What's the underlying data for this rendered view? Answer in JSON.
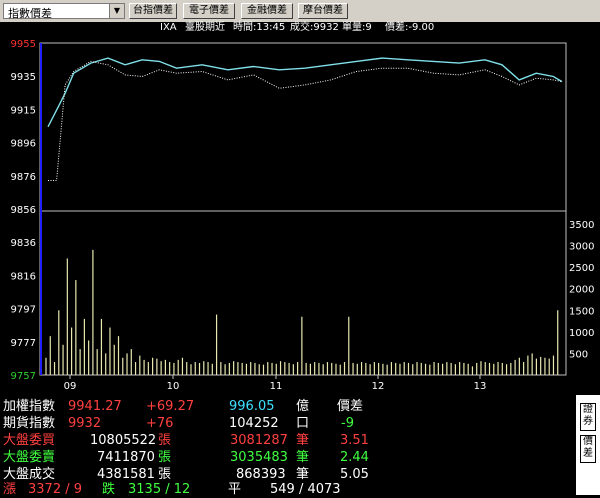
{
  "toolbar": {
    "selector_value": "指數價差",
    "buttons": [
      "台指價差",
      "電子價差",
      "金融價差",
      "摩台價差"
    ]
  },
  "info_bar": {
    "code": "IXA",
    "name": "臺股期近",
    "time": "時間:13:45",
    "deal": "成交:9932",
    "volume": "單量:9",
    "spread": "價差:-9.00"
  },
  "colors": {
    "index_line": "#7fe0e8",
    "futures_line": "#ffffff",
    "volume_bar": "#e8e8b0",
    "price_axis_text": "#ffffff",
    "top_price_text": "#ff3030",
    "base_price_text": "#30d030",
    "up": "#ff4040",
    "down": "#40ff40",
    "label_white": "#ffffff"
  },
  "chart_data": {
    "type": "line",
    "title": "",
    "price_axis": {
      "ticks": [
        "9955",
        "9935",
        "9915",
        "9896",
        "9876",
        "9856",
        "9836",
        "9816",
        "9797",
        "9777",
        "9757"
      ],
      "top": 9955,
      "bottom": 9757
    },
    "volume_axis": {
      "ticks": [
        "3500",
        "3000",
        "2500",
        "2000",
        "1500",
        "1000",
        "500"
      ],
      "max": 3800
    },
    "x_ticks": [
      "09",
      "10",
      "11",
      "12",
      "13"
    ],
    "series": [
      {
        "x": [
          "08:45",
          "08:50",
          "08:55",
          "09:00",
          "09:10",
          "09:20",
          "09:30",
          "09:40",
          "09:50",
          "10:00",
          "10:15",
          "10:30",
          "10:45",
          "11:00",
          "11:15",
          "11:30",
          "11:45",
          "12:00",
          "12:15",
          "12:30",
          "12:45",
          "13:00",
          "13:10",
          "13:20",
          "13:30",
          "13:40",
          "13:45"
        ],
        "values": [
          9905,
          9915,
          9925,
          9937,
          9943,
          9946,
          9942,
          9945,
          9944,
          9940,
          9942,
          9939,
          9941,
          9939,
          9940,
          9942,
          9944,
          9946,
          9945,
          9944,
          9943,
          9945,
          9942,
          9933,
          9937,
          9935,
          9932
        ]
      },
      {
        "x": [
          "08:45",
          "08:50",
          "08:55",
          "09:00",
          "09:10",
          "09:20",
          "09:30",
          "09:40",
          "09:50",
          "10:00",
          "10:15",
          "10:30",
          "10:45",
          "11:00",
          "11:15",
          "11:30",
          "11:45",
          "12:00",
          "12:15",
          "12:30",
          "12:45",
          "13:00",
          "13:10",
          "13:20",
          "13:30",
          "13:40",
          "13:45"
        ],
        "values": [
          9873,
          9873,
          9930,
          9938,
          9944,
          9942,
          9936,
          9935,
          9939,
          9937,
          9938,
          9933,
          9936,
          9928,
          9930,
          9933,
          9938,
          9940,
          9940,
          9937,
          9936,
          9939,
          9935,
          9930,
          9934,
          9933,
          9932
        ]
      }
    ],
    "volume": [
      400,
      900,
      300,
      1500,
      700,
      2700,
      1100,
      2200,
      600,
      1300,
      800,
      2900,
      600,
      1300,
      500,
      1100,
      700,
      900,
      400,
      500,
      600,
      300,
      450,
      350,
      300,
      400,
      380,
      320,
      350,
      300,
      280,
      350,
      400,
      300,
      250,
      300,
      280,
      320,
      300,
      260,
      1400,
      300,
      250,
      280,
      320,
      300,
      280,
      260,
      300,
      280,
      250,
      240,
      300,
      280,
      260,
      320,
      300,
      280,
      250,
      300,
      1350,
      280,
      260,
      300,
      280,
      250,
      300,
      280,
      260,
      240,
      300,
      1350,
      280,
      260,
      300,
      280,
      250,
      300,
      280,
      260,
      240,
      300,
      280,
      260,
      300,
      280,
      250,
      300,
      280,
      260,
      240,
      300,
      280,
      260,
      300,
      280,
      250,
      300,
      280,
      260,
      200,
      280,
      320,
      300,
      280,
      260,
      300,
      280,
      250,
      280,
      350,
      400,
      300,
      450,
      500,
      380,
      420,
      400,
      380,
      450,
      1500
    ]
  },
  "summary": [
    {
      "label": "加權指數",
      "v1": "9941.27",
      "v2": "+69.27",
      "v3": "996.05",
      "u3": "億",
      "v4": "價差"
    },
    {
      "label": "期貨指數",
      "v1": "9932",
      "v2": "+76",
      "v3": "104252",
      "u3": "口",
      "v4": "-9"
    },
    {
      "label": "大盤委買",
      "v1": "10805522",
      "u1": "張",
      "v3": "3081287",
      "u3": "筆",
      "v4": "3.51"
    },
    {
      "label": "大盤委賣",
      "v1": "7411870",
      "u1": "張",
      "v3": "3035483",
      "u3": "筆",
      "v4": "2.44"
    },
    {
      "label": "大盤成交",
      "v1": "4381581",
      "u1": "張",
      "v3": "868393",
      "u3": "筆",
      "v4": "5.05"
    }
  ],
  "breadth": {
    "up_label": "漲",
    "up_value": "3372 / 9",
    "down_label": "跌",
    "down_value": "3135 / 12",
    "flat_label": "平",
    "flat_value": "549 / 4073"
  },
  "side_tabs": [
    "證券",
    "價差"
  ]
}
